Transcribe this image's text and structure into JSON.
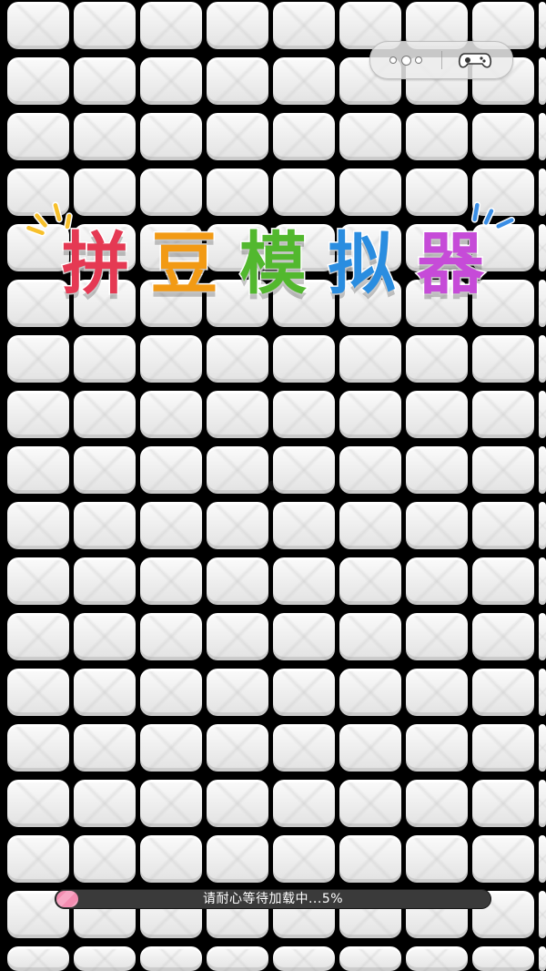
{
  "app": {
    "title_chars": [
      "拼",
      "豆",
      "模",
      "拟",
      "器"
    ],
    "title_colors": [
      "#e53953",
      "#f29a14",
      "#52b82e",
      "#2a8de0",
      "#c64bd8"
    ]
  },
  "capsule": {
    "menu_icon": "more-dots-icon",
    "game_icon": "gamepad-icon"
  },
  "loading": {
    "text": "请耐心等待加载中...5%",
    "progress": 0.05,
    "fill_color": "#f38cb0"
  },
  "board": {
    "tile_color": "#f2f2f2",
    "background": "#000000"
  }
}
